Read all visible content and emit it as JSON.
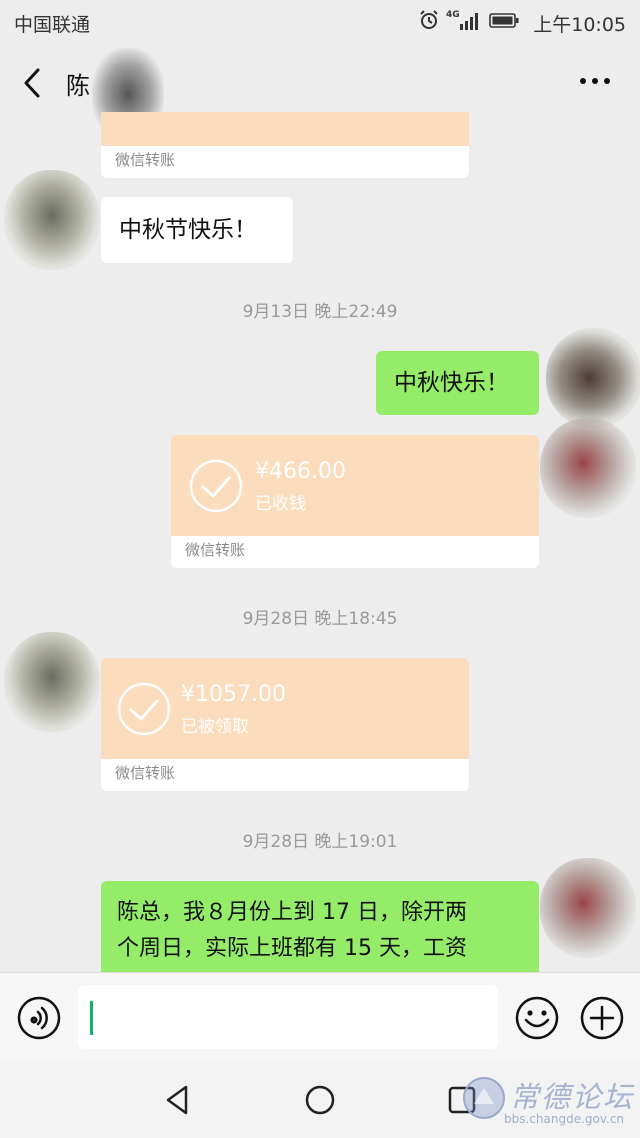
{
  "status_bar": {
    "carrier": "中国联通",
    "network": "4G",
    "time": "上午10:05"
  },
  "header": {
    "contact_name": "陈"
  },
  "messages": {
    "m1": {
      "footer": "微信转账"
    },
    "m2": {
      "text": "中秋节快乐！"
    },
    "t1": "9月13日 晚上22:49",
    "m3": {
      "text": "中秋快乐！"
    },
    "m4": {
      "amount": "¥466.00",
      "status": "已收钱",
      "footer": "微信转账"
    },
    "t2": "9月28日 晚上18:45",
    "m5": {
      "amount": "¥1057.00",
      "status": "已被领取",
      "footer": "微信转账"
    },
    "t3": "9月28日 晚上19:01",
    "m6": {
      "line1": "陈总，我８月份上到 17 日，除开两",
      "line2": "个周日，实际上班都有 15 天，工资"
    }
  },
  "watermark": {
    "name": "常德论坛",
    "url": "bbs.changde.gov.cn"
  },
  "colors": {
    "background": "#ededed",
    "green_bubble": "#95ec69",
    "transfer_card": "#fbdcbc",
    "caret": "#14b266"
  }
}
